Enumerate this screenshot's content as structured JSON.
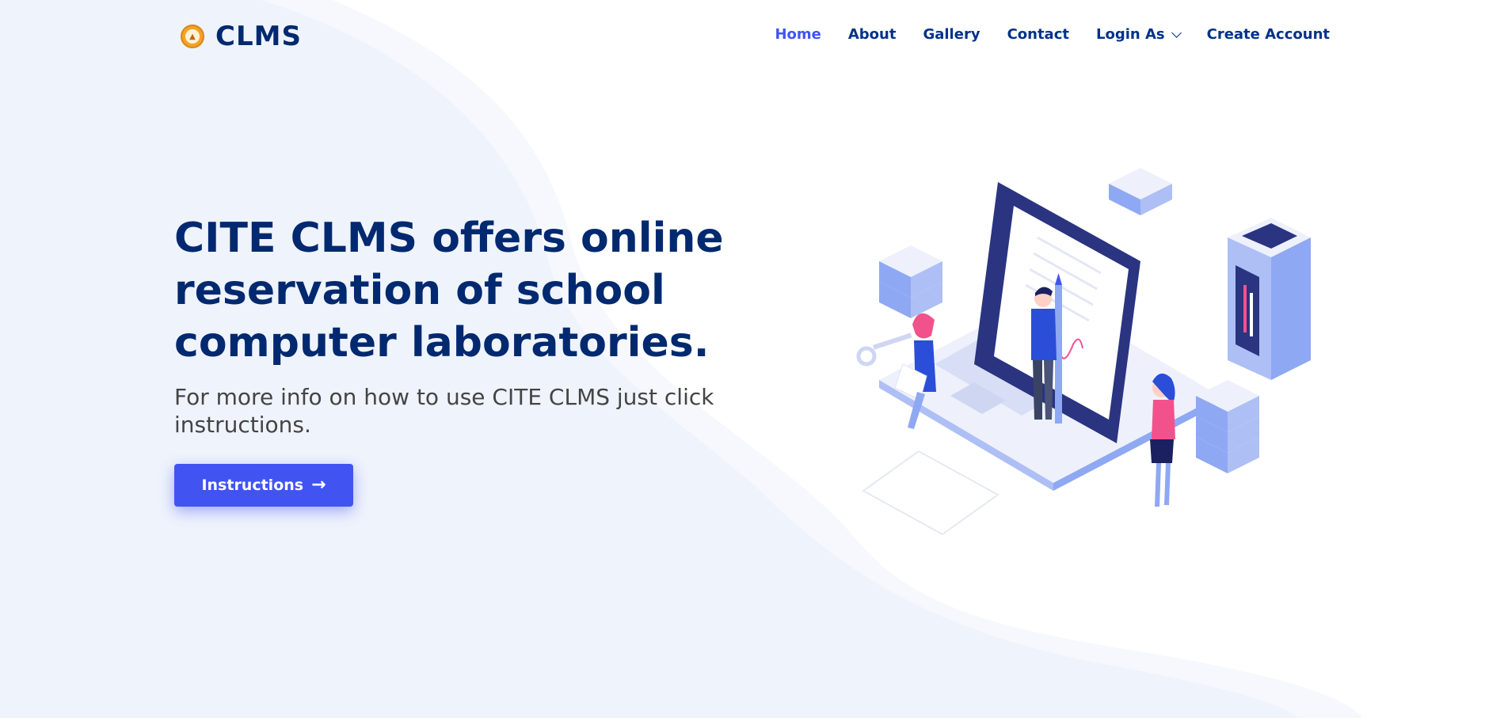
{
  "brand": {
    "name": "CLMS",
    "icon": "clms-logo-icon"
  },
  "nav": {
    "items": [
      {
        "label": "Home",
        "active": true
      },
      {
        "label": "About"
      },
      {
        "label": "Gallery"
      },
      {
        "label": "Contact"
      },
      {
        "label": "Login As",
        "dropdown": true,
        "icon": "chevron-down-icon"
      },
      {
        "label": "Create Account"
      }
    ]
  },
  "hero": {
    "title": "CITE CLMS offers online reservation of school computer laboratories.",
    "subtitle": "For more info on how to use CITE CLMS just click instructions.",
    "button_label": "Instructions",
    "button_icon": "arrow-right-icon",
    "illustration_icon": "laptop-team-illustration"
  },
  "colors": {
    "primary": "#4154f1",
    "heading": "#012970",
    "nav": "#013289",
    "background_tint": "#f0f4fc",
    "accent_pink": "#f2528c",
    "logo_orange": "#f3a323"
  }
}
